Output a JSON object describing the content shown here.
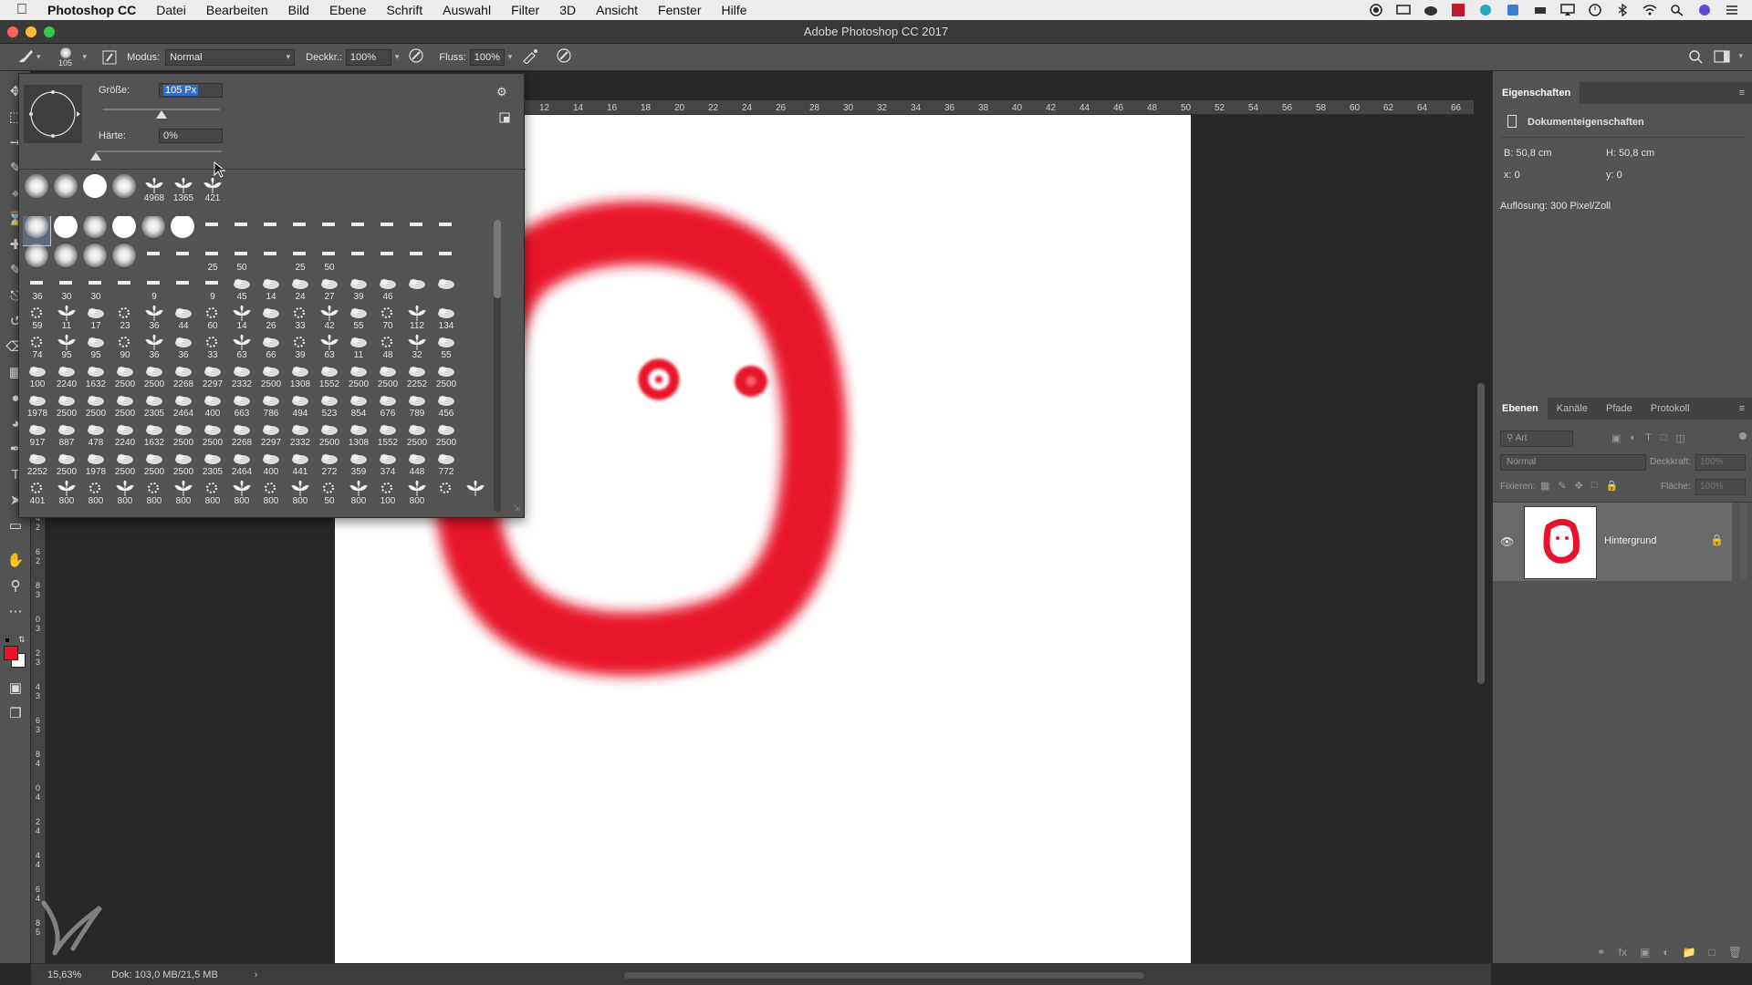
{
  "menubar": {
    "app_name": "Photoshop CC",
    "menus": [
      "Datei",
      "Bearbeiten",
      "Bild",
      "Ebene",
      "Schrift",
      "Auswahl",
      "Filter",
      "3D",
      "Ansicht",
      "Fenster",
      "Hilfe"
    ]
  },
  "window": {
    "title": "Adobe Photoshop CC 2017"
  },
  "options_bar": {
    "brush_size_label": "105",
    "mode_label": "Modus:",
    "mode_value": "Normal",
    "opacity_label": "Deckkr.:",
    "opacity_value": "100%",
    "flow_label": "Fluss:",
    "flow_value": "100%"
  },
  "brush_popup": {
    "size_label": "Größe:",
    "size_value": "105 Px",
    "size_slider_fraction": 0.5,
    "hardness_label": "Härte:",
    "hardness_value": "0%",
    "hardness_slider_fraction": 0.0,
    "recent_brushes": [
      "",
      "",
      "",
      "",
      "4968",
      "1365",
      "421"
    ],
    "grid_labels": [
      [
        "",
        "",
        "",
        "",
        "",
        "",
        "",
        "",
        "",
        "",
        "",
        "",
        "",
        "",
        ""
      ],
      [
        "",
        "",
        "",
        "",
        "",
        "",
        "25",
        "50",
        "",
        "25",
        "50",
        "",
        "",
        "",
        ""
      ],
      [
        "36",
        "30",
        "30",
        "",
        "9",
        "",
        "9",
        "45",
        "14",
        "24",
        "27",
        "39",
        "46",
        "",
        ""
      ],
      [
        "59",
        "11",
        "17",
        "23",
        "36",
        "44",
        "60",
        "14",
        "26",
        "33",
        "42",
        "55",
        "70",
        "112",
        "134"
      ],
      [
        "74",
        "95",
        "95",
        "90",
        "36",
        "36",
        "33",
        "63",
        "66",
        "39",
        "63",
        "11",
        "48",
        "32",
        "55"
      ],
      [
        "100",
        "2240",
        "1632",
        "2500",
        "2500",
        "2268",
        "2297",
        "2332",
        "2500",
        "1308",
        "1552",
        "2500",
        "2500",
        "2252",
        "2500"
      ],
      [
        "1978",
        "2500",
        "2500",
        "2500",
        "2305",
        "2464",
        "400",
        "663",
        "786",
        "494",
        "523",
        "854",
        "676",
        "789",
        "456"
      ],
      [
        "917",
        "887",
        "478",
        "2240",
        "1632",
        "2500",
        "2500",
        "2268",
        "2297",
        "2332",
        "2500",
        "1308",
        "1552",
        "2500",
        "2500"
      ],
      [
        "2252",
        "2500",
        "1978",
        "2500",
        "2500",
        "2500",
        "2305",
        "2464",
        "400",
        "441",
        "272",
        "359",
        "374",
        "448",
        "772"
      ],
      [
        "401",
        "800",
        "800",
        "800",
        "800",
        "800",
        "800",
        "800",
        "800",
        "800",
        "50",
        "800",
        "100",
        "800",
        "",
        ""
      ]
    ]
  },
  "rulers": {
    "horizontal": [
      "12",
      "14",
      "16",
      "18",
      "20",
      "22",
      "24",
      "26",
      "28",
      "30",
      "32",
      "34",
      "36",
      "38",
      "40",
      "42",
      "44",
      "46",
      "48",
      "50",
      "52",
      "54",
      "56",
      "58",
      "60",
      "62",
      "64",
      "66"
    ],
    "vertical": [
      "4",
      "2",
      "6",
      "2",
      "8",
      "3",
      "0",
      "3",
      "2",
      "3",
      "4",
      "3",
      "6",
      "3",
      "8",
      "4",
      "0",
      "4",
      "2",
      "4",
      "4",
      "4",
      "6",
      "4",
      "8",
      "5"
    ]
  },
  "properties_panel": {
    "title": "Eigenschaften",
    "section": "Dokumenteigenschaften",
    "width": "B: 50,8 cm",
    "height": "H: 50,8 cm",
    "x": "x: 0",
    "y": "y: 0",
    "resolution": "Auflösung: 300 Pixel/Zoll"
  },
  "layers_panel": {
    "tabs": [
      "Ebenen",
      "Kanäle",
      "Pfade",
      "Protokoll"
    ],
    "filter_placeholder": "Art",
    "blend_mode": "Normal",
    "opacity_label": "Deckkraft:",
    "opacity_value": "100%",
    "lock_label": "Fixieren:",
    "fill_label": "Fläche:",
    "fill_value": "100%",
    "layers": [
      {
        "name": "Hintergrund",
        "visible": true,
        "locked": true
      }
    ]
  },
  "status_bar": {
    "zoom": "15,63%",
    "doc_info": "Dok: 103,0 MB/21,5 MB"
  },
  "colors": {
    "foreground": "#e8132b",
    "background": "#ffffff",
    "stroke": "#e8132b"
  }
}
